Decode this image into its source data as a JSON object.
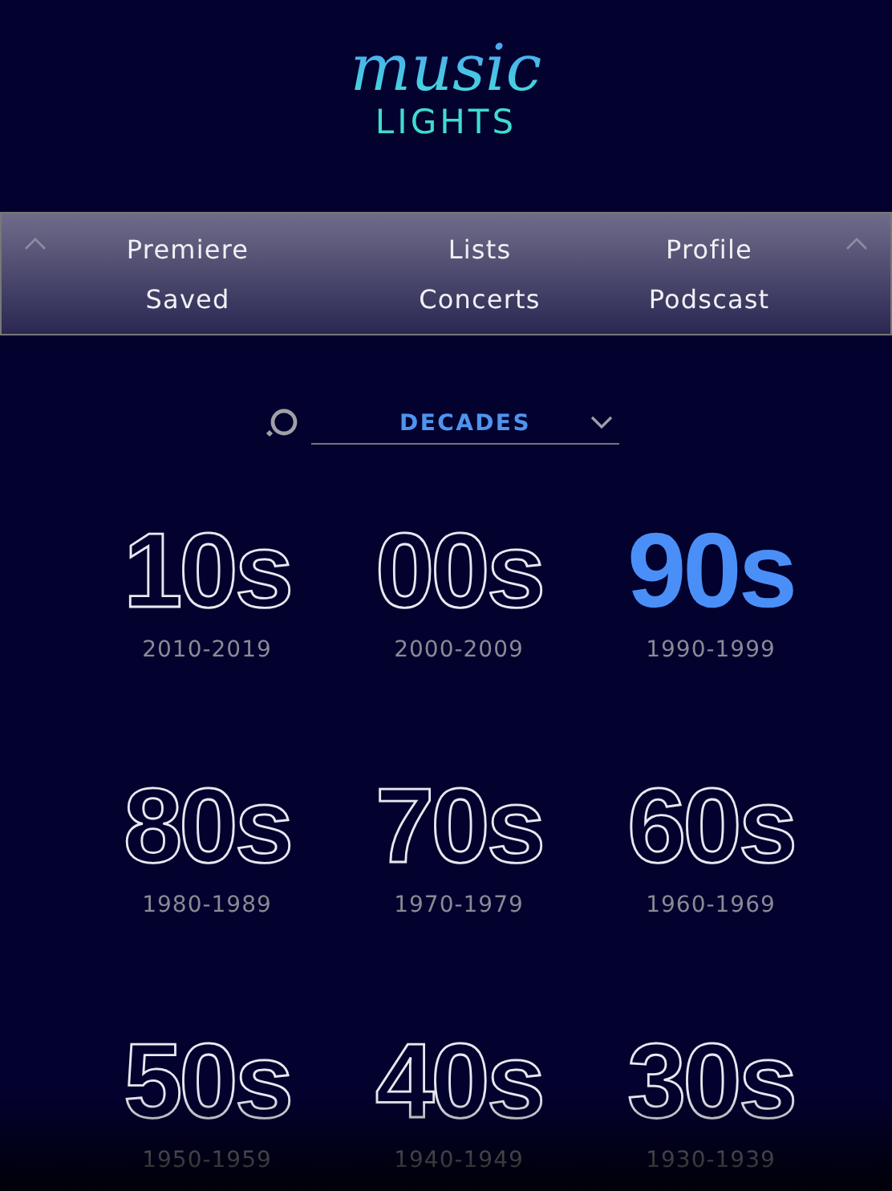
{
  "logo": {
    "top": "music",
    "bottom": "LIGHTS"
  },
  "nav": [
    {
      "label": "Premiere"
    },
    {
      "label": "Lists"
    },
    {
      "label": "Profile"
    },
    {
      "label": "Saved"
    },
    {
      "label": "Concerts"
    },
    {
      "label": "Podscast"
    }
  ],
  "filter": {
    "value": "DECADES"
  },
  "decades": [
    {
      "label": "10s",
      "range": "2010-2019",
      "selected": false
    },
    {
      "label": "00s",
      "range": "2000-2009",
      "selected": false
    },
    {
      "label": "90s",
      "range": "1990-1999",
      "selected": true
    },
    {
      "label": "80s",
      "range": "1980-1989",
      "selected": false
    },
    {
      "label": "70s",
      "range": "1970-1979",
      "selected": false
    },
    {
      "label": "60s",
      "range": "1960-1969",
      "selected": false
    },
    {
      "label": "50s",
      "range": "1950-1959",
      "selected": false
    },
    {
      "label": "40s",
      "range": "1940-1949",
      "selected": false
    },
    {
      "label": "30s",
      "range": "1930-1939",
      "selected": false
    }
  ]
}
